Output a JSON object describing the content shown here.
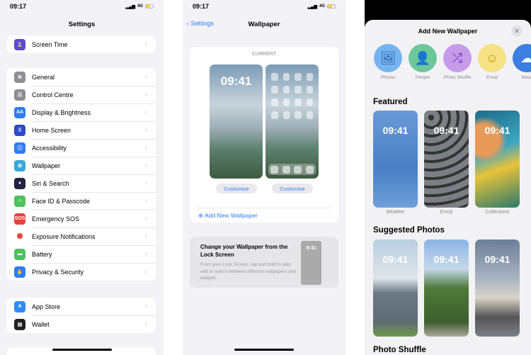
{
  "settings": {
    "time": "09:17",
    "network": "4G",
    "title": "Settings",
    "group1": [
      {
        "label": "Screen Time",
        "icon": "hourglass-icon",
        "color": "#5b4bd0"
      }
    ],
    "group2": [
      {
        "label": "General",
        "icon": "gear-icon",
        "color": "#8e8e93"
      },
      {
        "label": "Control Centre",
        "icon": "toggles-icon",
        "color": "#8e8e93"
      },
      {
        "label": "Display & Brightness",
        "icon": "text-size-icon",
        "color": "#2f7cf6"
      },
      {
        "label": "Home Screen",
        "icon": "app-grid-icon",
        "color": "#2c4ac8"
      },
      {
        "label": "Accessibility",
        "icon": "accessibility-icon",
        "color": "#2f7cf6"
      },
      {
        "label": "Wallpaper",
        "icon": "flower-icon",
        "color": "#38a8d8"
      },
      {
        "label": "Siri & Search",
        "icon": "siri-icon",
        "color": "#222244"
      },
      {
        "label": "Face ID & Passcode",
        "icon": "face-id-icon",
        "color": "#4cc35c"
      },
      {
        "label": "Emergency SOS",
        "icon": "sos-icon",
        "color": "#e8403a"
      },
      {
        "label": "Exposure Notifications",
        "icon": "exposure-icon",
        "color": "#ffffff"
      },
      {
        "label": "Battery",
        "icon": "battery-icon",
        "color": "#4cc35c"
      },
      {
        "label": "Privacy & Security",
        "icon": "hand-icon",
        "color": "#2f7cf6"
      }
    ],
    "group3": [
      {
        "label": "App Store",
        "icon": "app-store-icon",
        "color": "#2f8cf6"
      },
      {
        "label": "Wallet",
        "icon": "wallet-icon",
        "color": "#222"
      }
    ]
  },
  "wallpaper": {
    "time": "09:17",
    "network": "4G",
    "back": "Settings",
    "title": "Wallpaper",
    "current": "CURRENT",
    "lock_time": "09:41",
    "customise": "Customise",
    "add_new": "Add New Wallpaper",
    "info_title": "Change your Wallpaper from the Lock Screen",
    "info_body": "From your Lock Screen, tap and hold to add, edit or switch between different wallpapers and widgets.",
    "info_time": "9:41"
  },
  "add_new": {
    "title": "Add New Wallpaper",
    "types": [
      {
        "label": "Photos",
        "icon": "photos-icon",
        "color": "#74b4f0"
      },
      {
        "label": "People",
        "icon": "person-icon",
        "color": "#6cc79a"
      },
      {
        "label": "Photo Shuffle",
        "icon": "shuffle-icon",
        "color": "#c59bea"
      },
      {
        "label": "Emoji",
        "icon": "emoji-icon",
        "color": "#f6e184"
      },
      {
        "label": "Weat",
        "icon": "weather-icon",
        "color": "#3b7fe0"
      }
    ],
    "featured_title": "Featured",
    "featured": [
      {
        "label": "Weather",
        "time": "09:41"
      },
      {
        "label": "Emoji",
        "time": "09:41"
      },
      {
        "label": "Collections",
        "time": "09:41"
      }
    ],
    "suggested_title": "Suggested Photos",
    "suggested": [
      {
        "time": "09:41"
      },
      {
        "time": "09:41"
      },
      {
        "time": "09:41"
      }
    ],
    "shuffle_title": "Photo Shuffle"
  }
}
